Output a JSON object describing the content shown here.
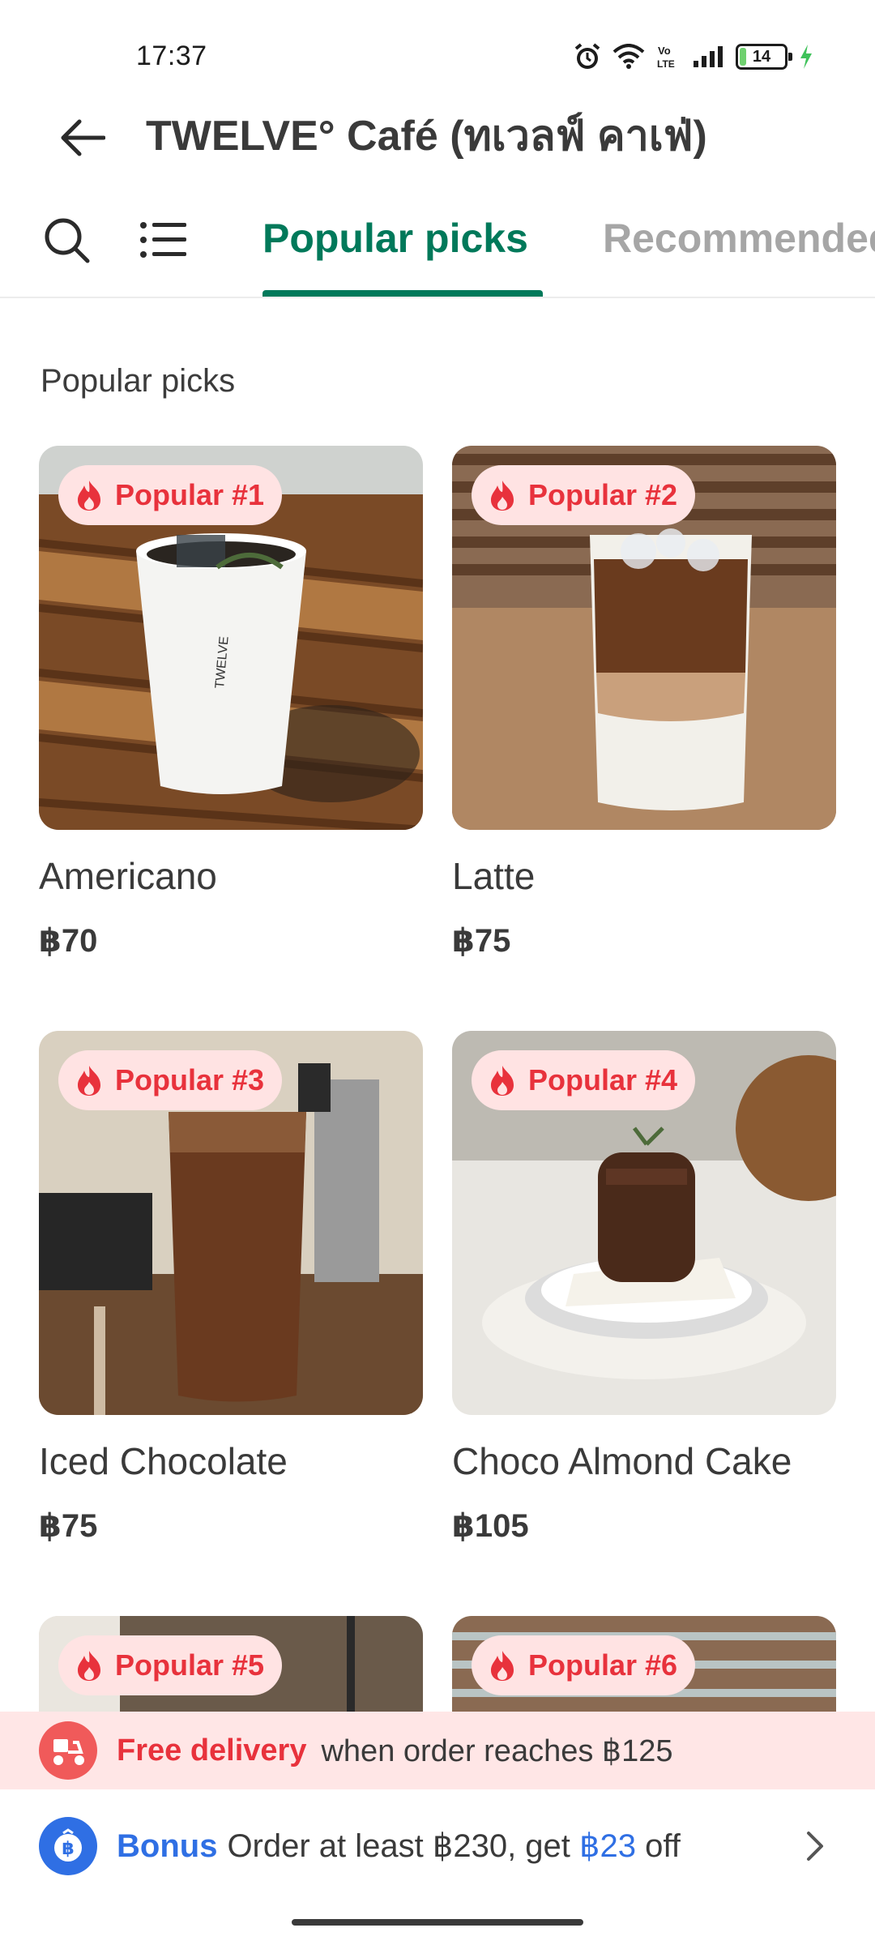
{
  "status_bar": {
    "time": "17:37",
    "battery_level": "14",
    "battery_fraction": 0.14,
    "icons": [
      "alarm-icon",
      "wifi-icon",
      "volte-icon",
      "signal-icon",
      "battery-icon",
      "charging-icon"
    ]
  },
  "header": {
    "title": "TWELVE° Café (ทเวลฟ์ คาเฟ่)",
    "back_icon": "arrow-left-icon"
  },
  "tabs": {
    "search_icon": "search-icon",
    "menu_icon": "list-icon",
    "items": [
      {
        "label": "Popular picks",
        "active": true
      },
      {
        "label": "Recommended",
        "active": false
      }
    ]
  },
  "section": {
    "title": "Popular picks"
  },
  "products": [
    {
      "badge": "Popular #1",
      "name": "Americano",
      "price": "฿70"
    },
    {
      "badge": "Popular #2",
      "name": "Latte",
      "price": "฿75"
    },
    {
      "badge": "Popular #3",
      "name": "Iced Chocolate",
      "price": "฿75"
    },
    {
      "badge": "Popular #4",
      "name": "Choco Almond Cake",
      "price": "฿105"
    },
    {
      "badge": "Popular #5",
      "name": "",
      "price": ""
    },
    {
      "badge": "Popular #6",
      "name": "",
      "price": ""
    }
  ],
  "delivery_banner": {
    "strong": "Free delivery",
    "text": "when order reaches ฿125"
  },
  "bonus_bar": {
    "strong": "Bonus",
    "text_before": "Order at least ฿230, get ",
    "amount": "฿23",
    "text_after": " off"
  },
  "colors": {
    "accent_green": "#00795a",
    "badge_red": "#e8323c",
    "badge_bg": "#ffe3e3",
    "bonus_blue": "#2f6fe4",
    "delivery_bg": "#ffe6e6"
  }
}
